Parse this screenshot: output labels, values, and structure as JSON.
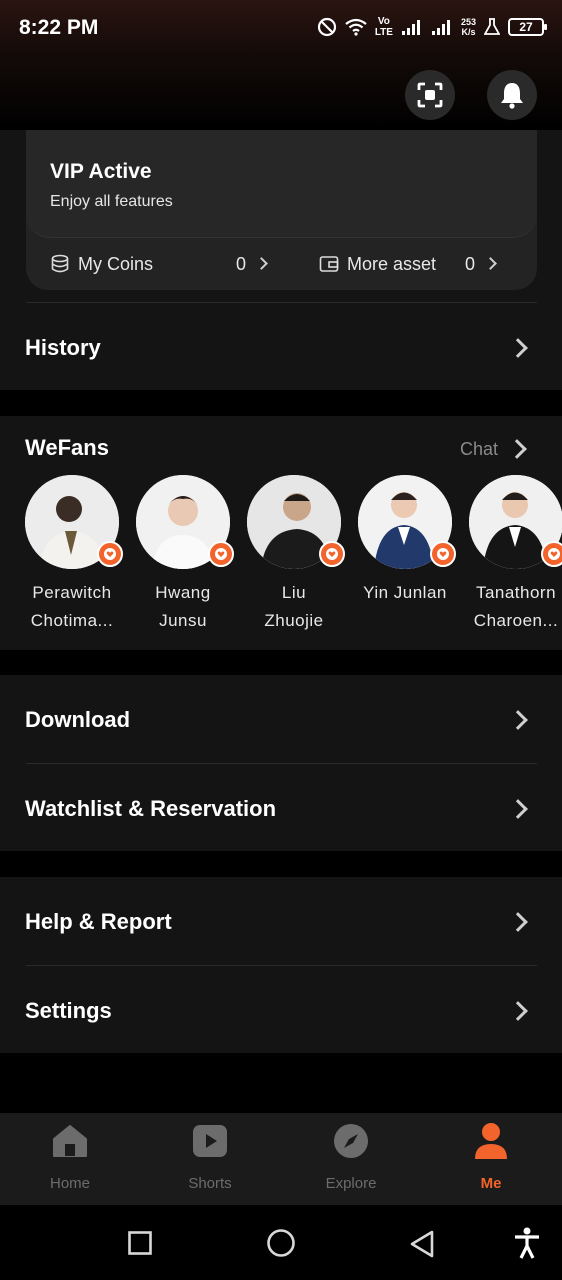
{
  "status_bar": {
    "time": "8:22 PM",
    "volte_line1": "Vo",
    "volte_line2": "LTE",
    "net_speed_value": "253",
    "net_speed_unit": "K/s",
    "battery": "27"
  },
  "vip": {
    "title": "VIP Active",
    "subtitle": "Enjoy all features",
    "coins_label": "My Coins",
    "coins_value": "0",
    "asset_label": "More asset",
    "asset_value": "0"
  },
  "history": {
    "label": "History"
  },
  "wefans": {
    "title": "WeFans",
    "chat_label": "Chat",
    "fans": [
      {
        "line1": "Perawitch",
        "line2": "Chotima..."
      },
      {
        "line1": "Hwang",
        "line2": "Junsu"
      },
      {
        "line1": "Liu",
        "line2": "Zhuojie"
      },
      {
        "line1": "Yin Junlan",
        "line2": ""
      },
      {
        "line1": "Tanathorn",
        "line2": "Charoen..."
      }
    ]
  },
  "menu": {
    "download": "Download",
    "watchlist": "Watchlist & Reservation",
    "help": "Help & Report",
    "settings": "Settings"
  },
  "bottom_nav": {
    "items": [
      {
        "label": "Home",
        "icon": "home-icon"
      },
      {
        "label": "Shorts",
        "icon": "play-icon"
      },
      {
        "label": "Explore",
        "icon": "compass-icon"
      },
      {
        "label": "Me",
        "icon": "person-icon"
      }
    ],
    "active": "Me"
  },
  "colors": {
    "accent": "#f2642b",
    "background": "#000000",
    "section": "#141414"
  }
}
